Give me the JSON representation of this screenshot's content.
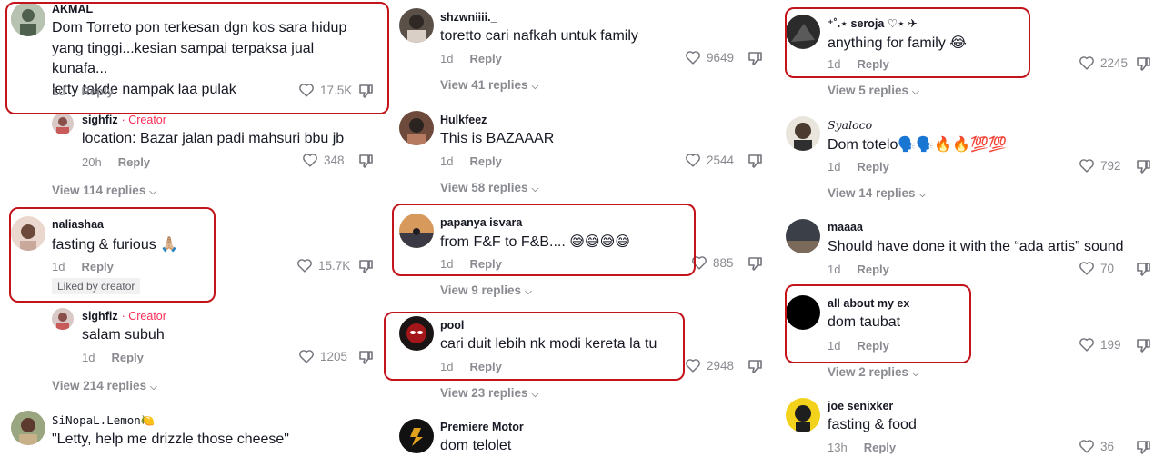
{
  "columns": [
    {
      "comments": [
        {
          "user": "AKMAL",
          "text": "Dom Torreto pon terkesan dgn kos sara hidup\nyang tinggi...kesian sampai terpaksa jual kunafa...\nletty takde nampak laa pulak",
          "time": "1d",
          "reply": "Reply",
          "likes": "17.5K"
        },
        {
          "user": "sighfiz",
          "creator": "· Creator",
          "text": "location: Bazar jalan padi mahsuri bbu jb",
          "time": "20h",
          "reply": "Reply",
          "likes": "348",
          "view_replies": "View 114 replies"
        },
        {
          "user": "naliashaa",
          "text": "fasting & furious 🙏🏼",
          "time": "1d",
          "reply": "Reply",
          "likes": "15.7K",
          "badge": "Liked by creator"
        },
        {
          "user": "sighfiz",
          "creator": "· Creator",
          "text": "salam subuh",
          "time": "1d",
          "reply": "Reply",
          "likes": "1205",
          "view_replies": "View 214 replies"
        },
        {
          "user": "SiNopaL.Lemon🍋",
          "text": "\"Letty, help me drizzle those cheese\""
        }
      ]
    },
    {
      "comments": [
        {
          "user": "shzwniiii._",
          "text": "toretto cari nafkah untuk family",
          "time": "1d",
          "reply": "Reply",
          "likes": "9649",
          "view_replies": "View 41 replies"
        },
        {
          "user": "Hulkfeez",
          "text": "This is BAZAAAR",
          "time": "1d",
          "reply": "Reply",
          "likes": "2544",
          "view_replies": "View 58 replies"
        },
        {
          "user": "papanya isvara",
          "text": "from F&F to F&B.... 😅😅😅😅",
          "time": "1d",
          "reply": "Reply",
          "likes": "885",
          "view_replies": "View 9 replies"
        },
        {
          "user": "pool",
          "text": "cari duit lebih nk modi kereta la tu",
          "time": "1d",
          "reply": "Reply",
          "likes": "2948",
          "view_replies": "View 23 replies"
        },
        {
          "user": "Premiere Motor",
          "text": "dom telolet"
        }
      ]
    },
    {
      "comments": [
        {
          "user": "⁺˚.⋆ seroja ♡⋆ ✈",
          "text": "anything for family 😂",
          "time": "1d",
          "reply": "Reply",
          "likes": "2245",
          "view_replies": "View 5 replies"
        },
        {
          "user": "Syaloco",
          "text": "Dom totelo🗣️🗣️🔥🔥💯💯",
          "time": "1d",
          "reply": "Reply",
          "likes": "792",
          "view_replies": "View 14 replies"
        },
        {
          "user": "maaaa",
          "text": "Should have done it with the “ada artis” sound",
          "time": "1d",
          "reply": "Reply",
          "likes": "70"
        },
        {
          "user": "all about my ex",
          "text": "dom taubat",
          "time": "1d",
          "reply": "Reply",
          "likes": "199",
          "view_replies": "View 2 replies"
        },
        {
          "user": "joe senixker",
          "text": "fasting & food",
          "time": "13h",
          "reply": "Reply",
          "likes": "36"
        }
      ]
    }
  ],
  "icons": {
    "like": "heart-outline-icon",
    "dislike": "thumbs-down-icon",
    "expand": "chevron-down-icon"
  },
  "colors": {
    "highlight": "#c4141b",
    "creator": "#fe2c55",
    "muted": "#8a8b91"
  }
}
